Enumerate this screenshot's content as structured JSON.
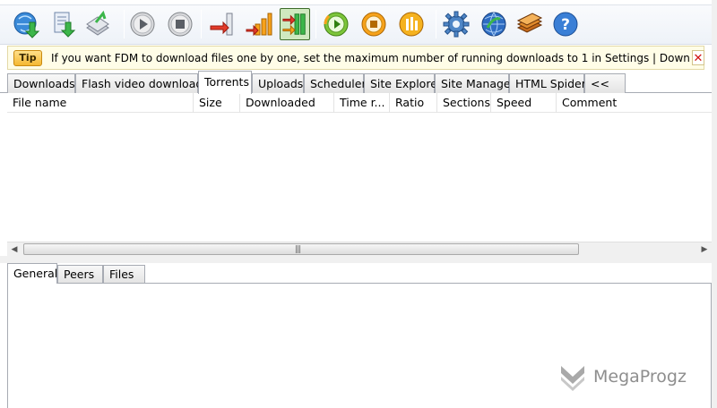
{
  "toolbar": {
    "buttons": [
      {
        "name": "add-download-icon"
      },
      {
        "name": "add-batch-download-icon"
      },
      {
        "name": "delete-icon"
      },
      {
        "name": "start-icon"
      },
      {
        "name": "stop-icon"
      },
      {
        "name": "move-down-icon"
      },
      {
        "name": "move-up-icon"
      },
      {
        "name": "traffic-mode-icon"
      },
      {
        "name": "schedule-start-icon"
      },
      {
        "name": "schedule-stop-icon"
      },
      {
        "name": "options-icon"
      },
      {
        "name": "settings-icon"
      },
      {
        "name": "network-icon"
      },
      {
        "name": "books-icon"
      },
      {
        "name": "help-icon"
      }
    ]
  },
  "tip": {
    "badge": "Tip",
    "text": "If you want FDM to download files one by one, set the maximum number of running downloads to 1 in Settings | Downloads | Network, or click",
    "close": "✕"
  },
  "tabs": [
    {
      "label": "Downloads"
    },
    {
      "label": "Flash video downloads"
    },
    {
      "label": "Torrents",
      "active": true
    },
    {
      "label": "Uploads"
    },
    {
      "label": "Scheduler"
    },
    {
      "label": "Site Explorer"
    },
    {
      "label": "Site Manager"
    },
    {
      "label": "HTML Spider"
    },
    {
      "label": "<<"
    }
  ],
  "columns": [
    "File name",
    "Size",
    "Downloaded",
    "Time r...",
    "Ratio",
    "Sections",
    "Speed",
    "Comment"
  ],
  "scrollbar": {
    "left": "◀",
    "right": "▶",
    "grip": "|||"
  },
  "bottom_tabs": [
    {
      "label": "General",
      "active": true
    },
    {
      "label": "Peers"
    },
    {
      "label": "Files"
    }
  ],
  "watermark": {
    "text": "MegaProgz"
  },
  "colors": {
    "accent_green": "#3c6b2a",
    "tip_bg": "#fffde7",
    "close_red": "#d01010"
  }
}
